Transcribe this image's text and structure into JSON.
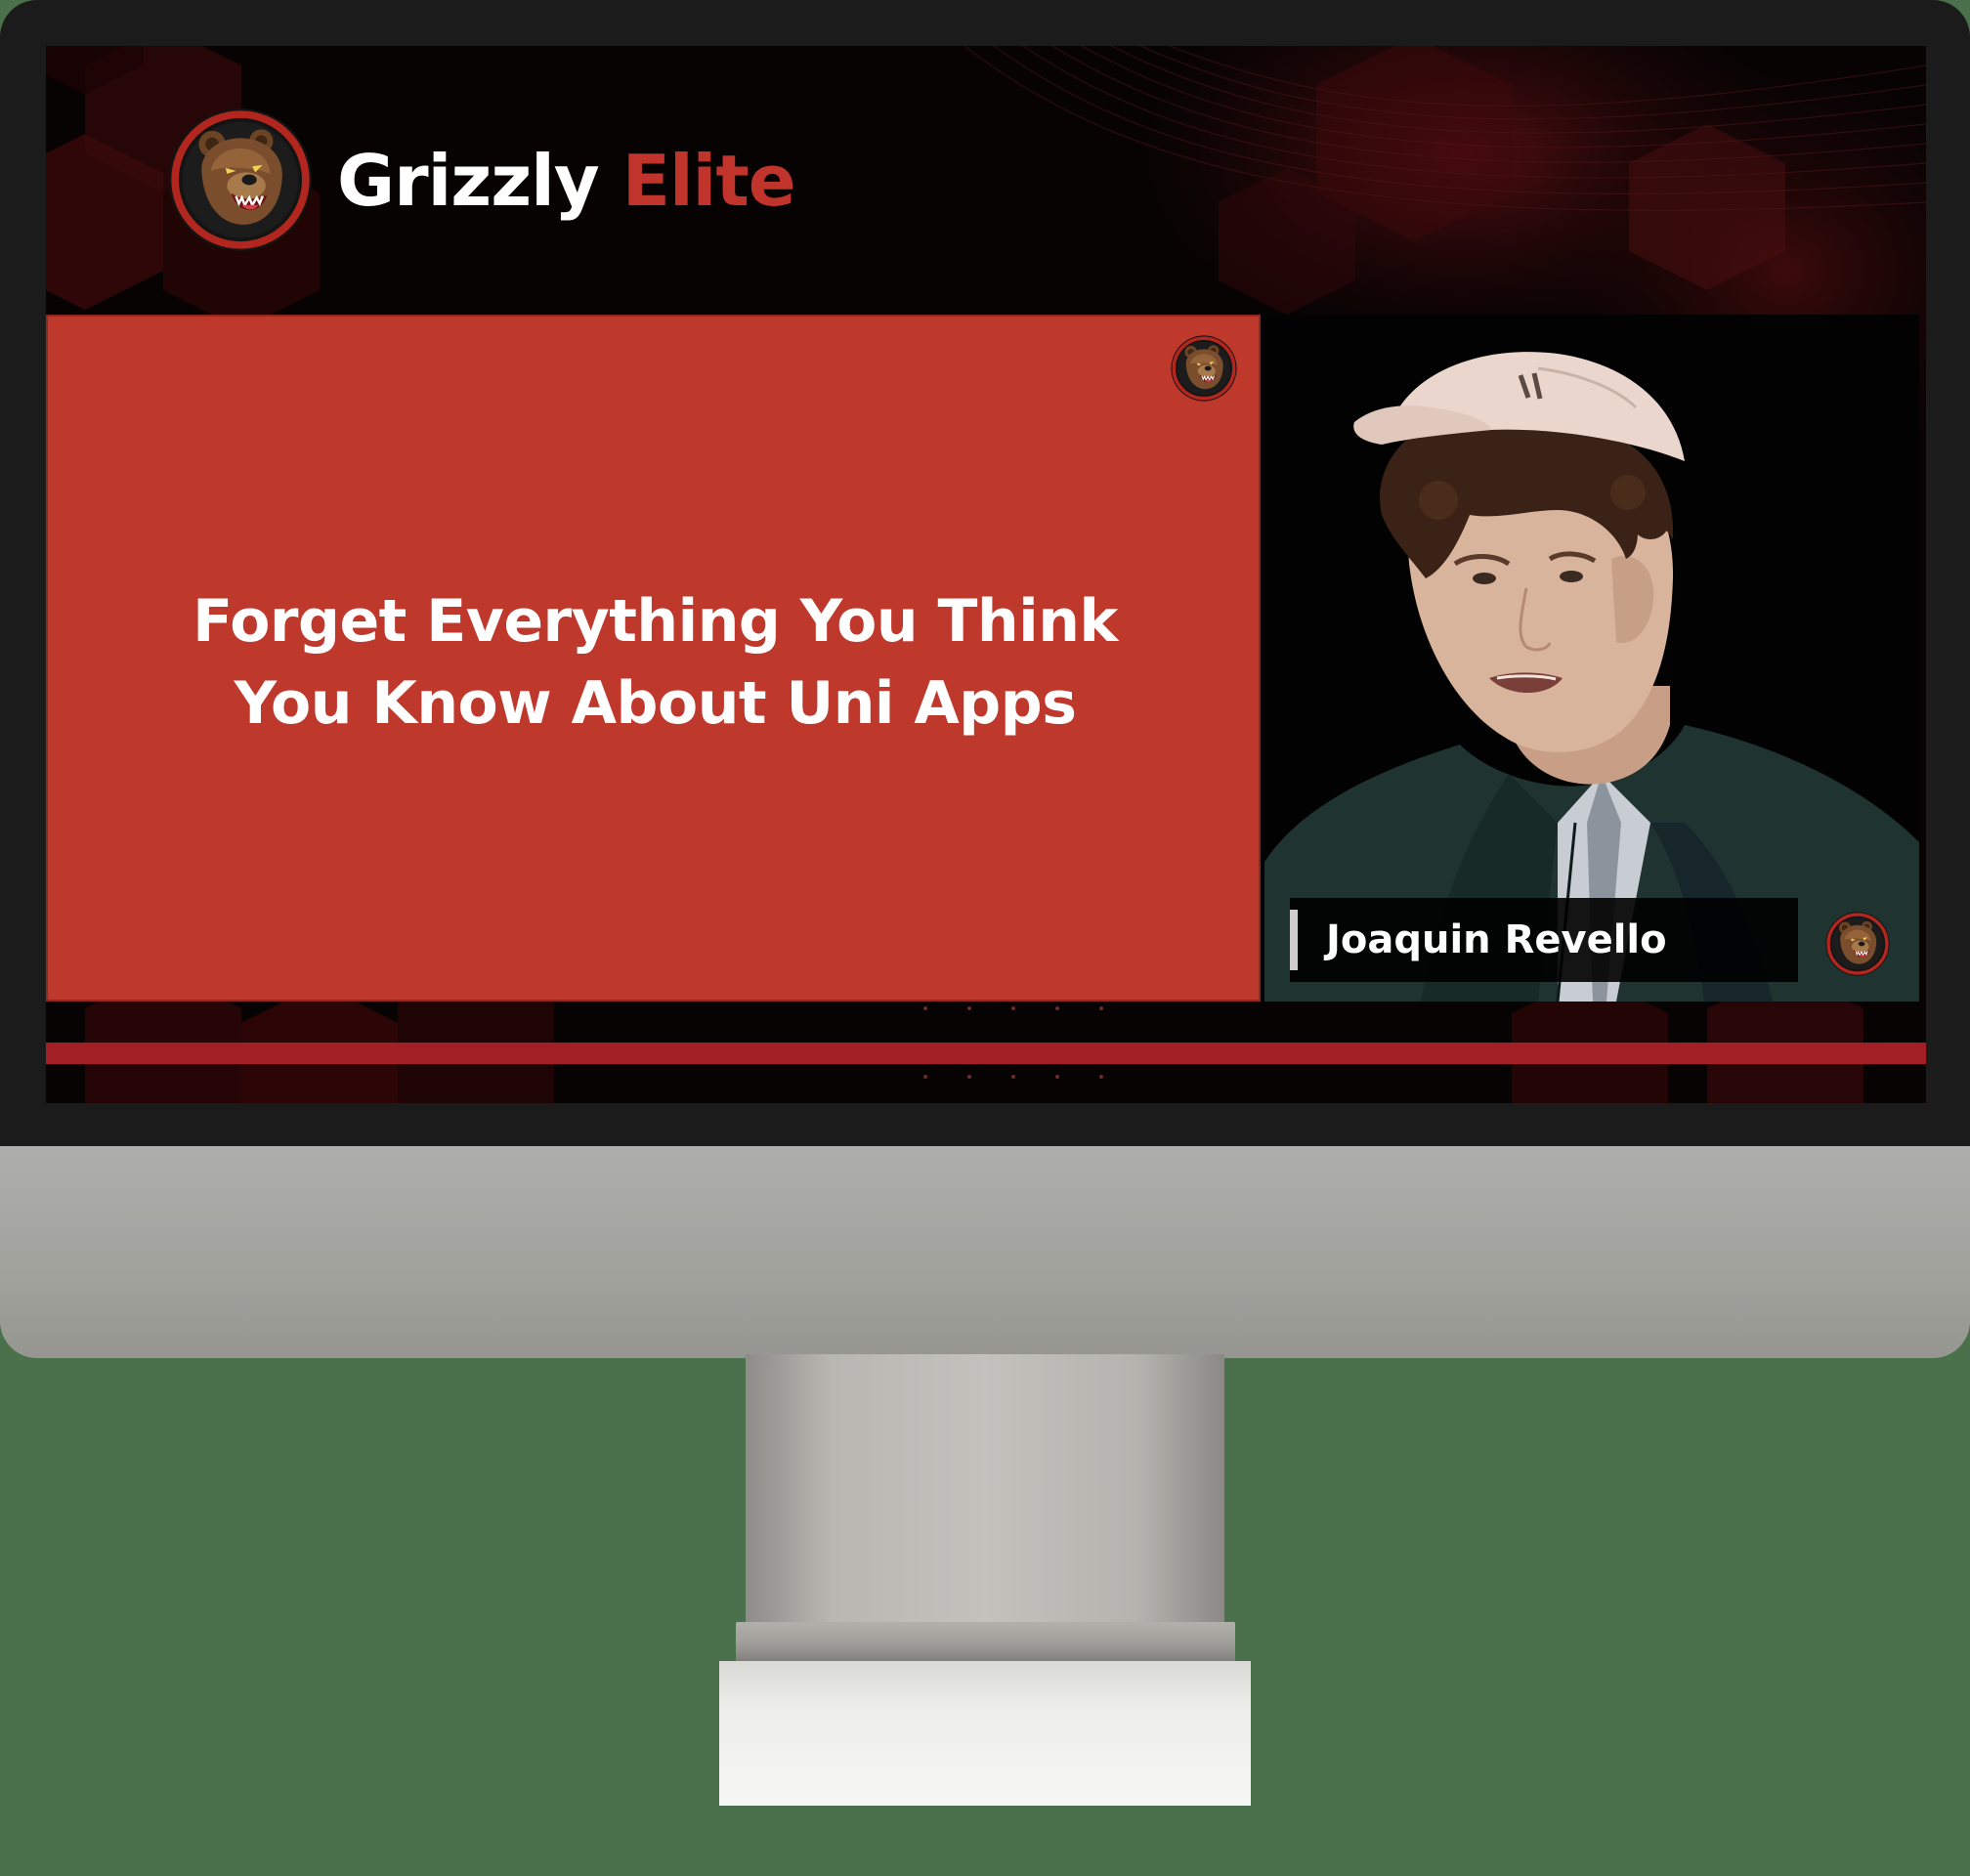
{
  "brand": {
    "name_first": "Grizzly",
    "name_second": "Elite",
    "logo_icon": "grizzly-bear-logo-icon"
  },
  "slide": {
    "title_line1": "Forget Everything You Think",
    "title_line2": "You Know About Uni Apps"
  },
  "webcam": {
    "presenter_name": "Joaquin Revello"
  },
  "colors": {
    "accent_red": "#bf382c",
    "brand_red": "#c0342b",
    "bar_red": "#a11f25",
    "screen_bg": "#050505",
    "outer_bg": "#4a714b"
  }
}
